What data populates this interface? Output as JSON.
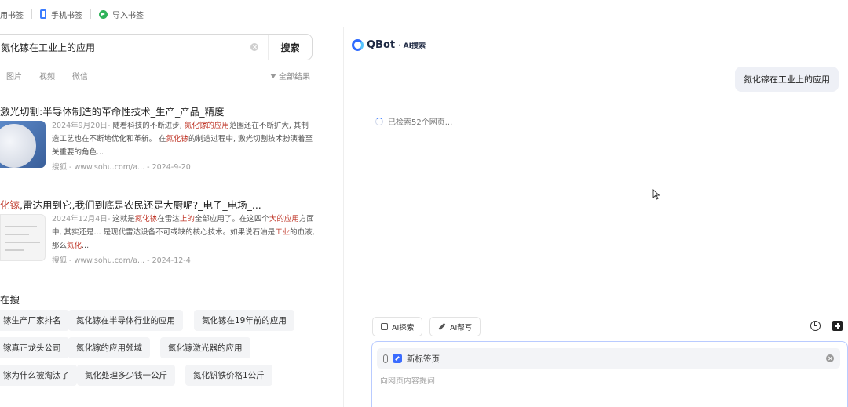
{
  "bookmarks": {
    "items": [
      {
        "label": "用书签",
        "icon": "bookmark-icon"
      },
      {
        "label": "手机书签",
        "icon": "phone-icon"
      },
      {
        "label": "导入书签",
        "icon": "import-icon"
      }
    ]
  },
  "search": {
    "query": "氮化镓在工业上的应用",
    "button": "搜索",
    "tabs": [
      "图片",
      "视频",
      "微信"
    ],
    "filter_label": "全部结果"
  },
  "results": [
    {
      "title": "激光切割:半导体制造的革命性技术_生产_产品_精度",
      "date": "2024年9月20日",
      "snippet_parts": [
        "随着科技的不断进步, ",
        "氮化镓的应用",
        "范围还在不断扩大, 其制造工艺也在不断地优化和革新。 在",
        "氮化镓",
        "的制造过程中, 激光切割技术扮演着至关重要的角色..."
      ],
      "source": "搜狐 - www.sohu.com/a...",
      "source_date": "2024-9-20"
    },
    {
      "title_parts": [
        "化镓",
        ",雷达用到它,我们到底是农民还是大厨呢?_电子_电场_..."
      ],
      "date": "2024年12月4日",
      "snippet_parts": [
        "这就是",
        "氮化镓",
        "在雷达",
        "上的",
        "全部应用了。在这四个",
        "大的应用",
        "方面中, 其实还是... 是现代雷达设备不可或缺的核心技术。如果说石油是",
        "工业",
        "的血液, 那么",
        "氮化",
        "..."
      ],
      "source": "搜狐 - www.sohu.com/a...",
      "source_date": "2024-12-4"
    }
  ],
  "hot": {
    "title": "在搜",
    "chips": [
      "镓生产厂家排名",
      "氮化镓在半导体行业的应用",
      "氮化镓在19年前的应用",
      "镓真正龙头公司",
      "氮化镓的应用领域",
      "氮化镓激光器的应用",
      "镓为什么被淘汰了",
      "氮化处理多少钱一公斤",
      "氮化钒铁价格1公斤"
    ]
  },
  "ai_panel": {
    "brand": "QBot",
    "brand_sub": "· AI搜索",
    "user_message": "氮化镓在工业上的应用",
    "status": "已检索52个网页...",
    "tools": [
      {
        "label": "AI探索",
        "icon": "ai-explore-icon"
      },
      {
        "label": "AI帮写",
        "icon": "ai-write-icon"
      }
    ],
    "context_tab": "新标签页",
    "prompt_placeholder": "向网页内容提问"
  }
}
